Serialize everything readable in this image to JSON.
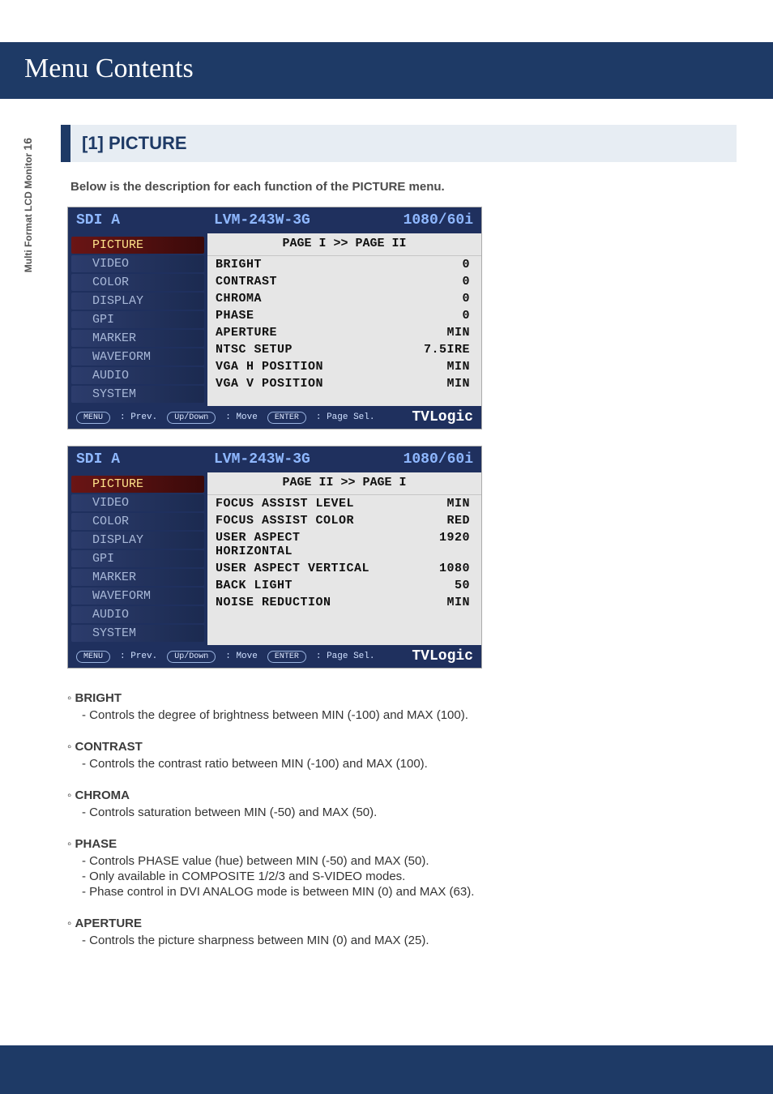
{
  "doc": {
    "title": "Menu Contents",
    "side_label": "Multi Format LCD Monitor",
    "page_num": "16",
    "section": "[1] PICTURE",
    "intro": "Below is the description for each function of the PICTURE menu."
  },
  "sidebar": {
    "items": [
      {
        "label": "PICTURE"
      },
      {
        "label": "VIDEO"
      },
      {
        "label": "COLOR"
      },
      {
        "label": "DISPLAY"
      },
      {
        "label": "GPI"
      },
      {
        "label": "MARKER"
      },
      {
        "label": "WAVEFORM"
      },
      {
        "label": "AUDIO"
      },
      {
        "label": "SYSTEM"
      }
    ]
  },
  "osd_common": {
    "input": "SDI A",
    "model": "LVM-243W-3G",
    "format": "1080/60i",
    "brand": "TVLogic",
    "hint_menu_key": "MENU",
    "hint_menu_txt": ": Prev.",
    "hint_updown_key": "Up/Down",
    "hint_updown_txt": ": Move",
    "hint_enter_key": "ENTER",
    "hint_enter_txt": ": Page Sel."
  },
  "osd_pages": [
    {
      "page_indicator": "PAGE I >> PAGE II",
      "rows": [
        {
          "label": "BRIGHT",
          "value": "0"
        },
        {
          "label": "CONTRAST",
          "value": "0"
        },
        {
          "label": "CHROMA",
          "value": "0"
        },
        {
          "label": "PHASE",
          "value": "0"
        },
        {
          "label": "APERTURE",
          "value": "MIN"
        },
        {
          "label": "NTSC SETUP",
          "value": "7.5IRE"
        },
        {
          "label": "VGA H POSITION",
          "value": "MIN"
        },
        {
          "label": "VGA V POSITION",
          "value": "MIN"
        }
      ]
    },
    {
      "page_indicator": "PAGE II >> PAGE I",
      "rows": [
        {
          "label": "FOCUS ASSIST LEVEL",
          "value": "MIN"
        },
        {
          "label": "FOCUS ASSIST COLOR",
          "value": "RED"
        },
        {
          "label": "USER ASPECT HORIZONTAL",
          "value": "1920"
        },
        {
          "label": "USER ASPECT VERTICAL",
          "value": "1080"
        },
        {
          "label": "BACK LIGHT",
          "value": "50"
        },
        {
          "label": "NOISE REDUCTION",
          "value": "MIN"
        }
      ]
    }
  ],
  "defs": [
    {
      "title": "BRIGHT",
      "lines": [
        "- Controls the degree of brightness between MIN (-100) and MAX (100)."
      ]
    },
    {
      "title": "CONTRAST",
      "lines": [
        "- Controls the contrast ratio between MIN (-100) and MAX (100)."
      ]
    },
    {
      "title": "CHROMA",
      "lines": [
        "- Controls saturation between MIN (-50) and MAX (50)."
      ]
    },
    {
      "title": "PHASE",
      "lines": [
        "- Controls PHASE value (hue) between MIN (-50) and MAX (50).",
        "- Only available in COMPOSITE 1/2/3 and S-VIDEO modes.",
        "- Phase control in DVI ANALOG mode is between MIN (0) and MAX (63)."
      ]
    },
    {
      "title": "APERTURE",
      "lines": [
        "- Controls the picture sharpness between MIN (0) and MAX (25)."
      ]
    }
  ]
}
